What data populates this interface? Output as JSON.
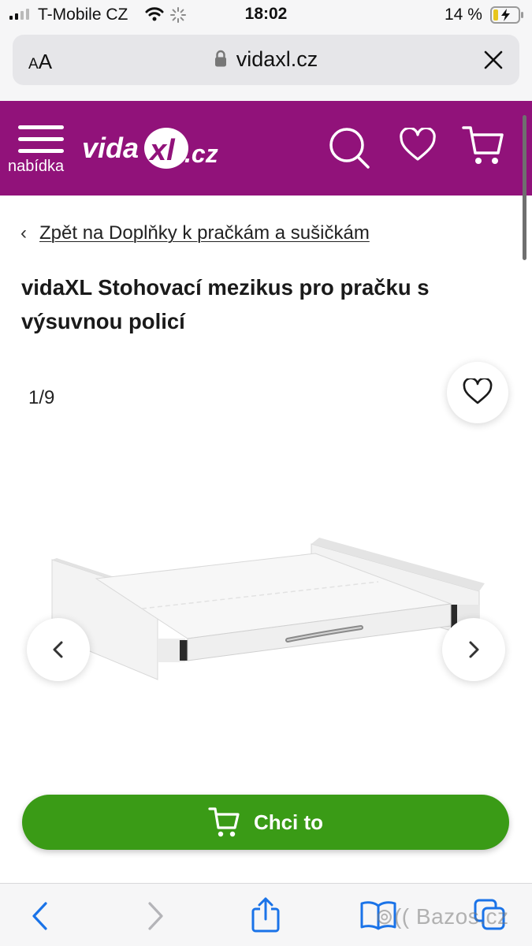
{
  "status_bar": {
    "carrier": "T-Mobile CZ",
    "time": "18:02",
    "battery_percent": "14 %",
    "icons": [
      "signal-icon",
      "wifi-icon",
      "activity-spinner-icon",
      "battery-charging-icon"
    ]
  },
  "url_bar": {
    "aa_small": "A",
    "aa_large": "A",
    "domain": "vidaxl.cz",
    "icons": [
      "lock-icon",
      "close-icon"
    ]
  },
  "header": {
    "menu_label": "nabídka",
    "logo_alt": "vidaXL.cz",
    "brand_color": "#91127a",
    "icons": [
      "hamburger-menu-icon",
      "search-icon",
      "heart-icon",
      "cart-icon"
    ]
  },
  "breadcrumb": {
    "label": "Zpět na Doplňky k pračkám a sušičkám"
  },
  "product": {
    "title": "vidaXL Stohovací mezikus pro pračku s výsuvnou policí"
  },
  "gallery": {
    "counter": "1/9",
    "current_image": 1,
    "total_images": 9
  },
  "cta": {
    "label": "Chci to",
    "color": "#3a9b16"
  },
  "toolbar": {
    "icons": [
      "back-arrow-icon",
      "forward-arrow-icon",
      "share-icon",
      "bookmarks-icon",
      "tabs-icon"
    ]
  },
  "watermark": {
    "text": "Bazos.cz"
  }
}
